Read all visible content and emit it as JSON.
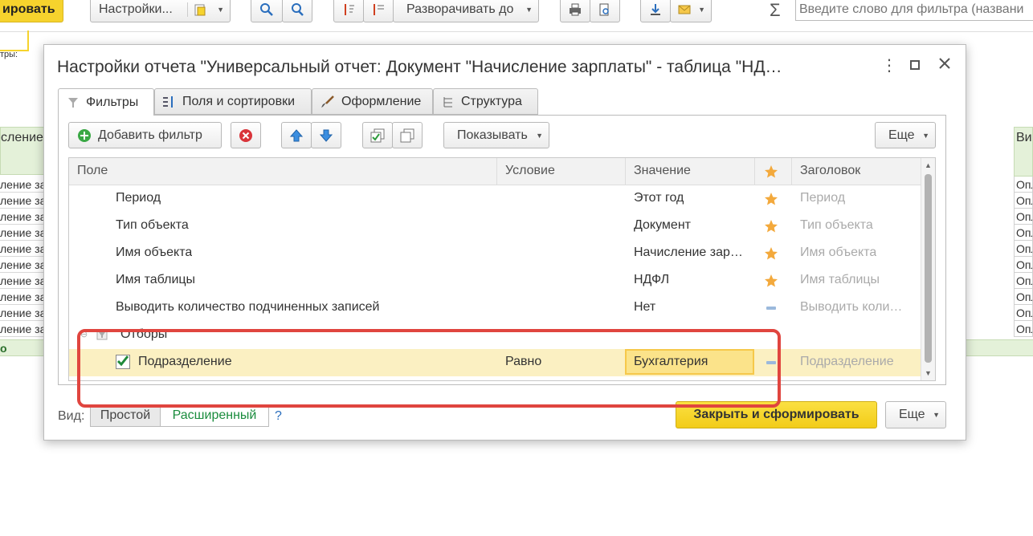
{
  "toolbar": {
    "generate_label": "ировать",
    "settings_label": "Настройки...",
    "expand_label": "Разворачивать до",
    "search_placeholder": "Введите слово для фильтра (названи"
  },
  "background": {
    "filters_label": "тры:",
    "column_header_left": "сление",
    "column_header_right": "Ви",
    "rows_left": [
      "ление за",
      "ление за",
      "ление за",
      "ление за",
      "ление за",
      "ление за",
      "ление за",
      "ление за",
      "ление за",
      "ление за"
    ],
    "rows_right": [
      "Опл",
      "Опл",
      "Опл",
      "Опл",
      "Опл",
      "Опл",
      "Опл",
      "Опл",
      "Опл",
      "Опл"
    ],
    "total_left": "о"
  },
  "dialog": {
    "title": "Настройки отчета \"Универсальный отчет: Документ \"Начисление зарплаты\" - таблица \"НД…",
    "tabs": [
      {
        "label": "Фильтры",
        "icon": "funnel-icon"
      },
      {
        "label": "Поля и сортировки",
        "icon": "sort-fields-icon"
      },
      {
        "label": "Оформление",
        "icon": "brush-icon"
      },
      {
        "label": "Структура",
        "icon": "structure-icon"
      }
    ],
    "add_filter_label": "Добавить фильтр",
    "show_label": "Показывать",
    "more_label": "Еще",
    "table": {
      "headers": {
        "field": "Поле",
        "condition": "Условие",
        "value": "Значение",
        "title": "Заголовок"
      },
      "rows": [
        {
          "field": "Период",
          "condition": "",
          "value": "Этот год",
          "star": true,
          "title": "Период"
        },
        {
          "field": "Тип объекта",
          "condition": "",
          "value": "Документ",
          "star": true,
          "title": "Тип объекта"
        },
        {
          "field": "Имя объекта",
          "condition": "",
          "value": "Начисление зар…",
          "star": true,
          "title": "Имя объекта"
        },
        {
          "field": "Имя таблицы",
          "condition": "",
          "value": "НДФЛ",
          "star": true,
          "title": "Имя таблицы"
        },
        {
          "field": "Выводить количество подчиненных записей",
          "condition": "",
          "value": "Нет",
          "star": false,
          "title": "Выводить коли…"
        }
      ],
      "group_label": "Отборы",
      "selected_row": {
        "field": "Подразделение",
        "condition": "Равно",
        "value": "Бухгалтерия",
        "checked": true,
        "title": "Подразделение"
      }
    },
    "view_label": "Вид:",
    "view_simple": "Простой",
    "view_advanced": "Расширенный",
    "help": "?",
    "close_generate_label": "Закрыть и сформировать",
    "footer_more_label": "Еще"
  },
  "colors": {
    "accent_yellow": "#f6d32d",
    "selected_row_bg": "#fbf0c2",
    "star_orange": "#f3a93c",
    "highlight_frame_red": "#e0453f",
    "advanced_green": "#1a8c3d"
  }
}
